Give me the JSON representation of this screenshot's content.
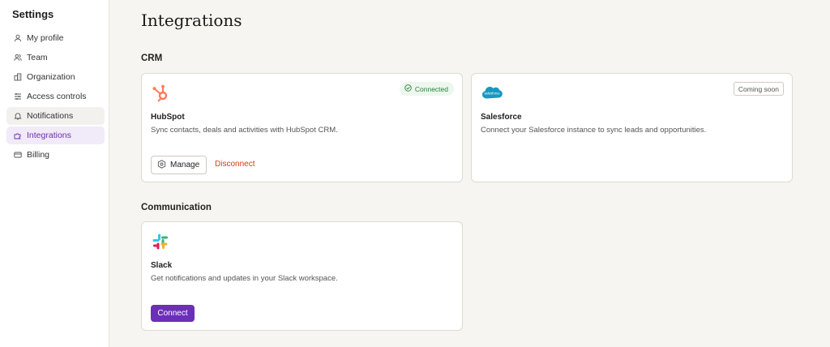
{
  "sidebar": {
    "title": "Settings",
    "items": [
      {
        "label": "My profile",
        "icon": "user-icon"
      },
      {
        "label": "Team",
        "icon": "users-icon"
      },
      {
        "label": "Organization",
        "icon": "building-icon"
      },
      {
        "label": "Access controls",
        "icon": "sliders-icon"
      },
      {
        "label": "Notifications",
        "icon": "bell-icon"
      },
      {
        "label": "Integrations",
        "icon": "puzzle-icon"
      },
      {
        "label": "Billing",
        "icon": "credit-card-icon"
      }
    ],
    "active_item": "Integrations"
  },
  "main": {
    "title": "Integrations",
    "sections": [
      {
        "title": "CRM",
        "cards": [
          {
            "name": "HubSpot",
            "description": "Sync contacts, deals and activities with HubSpot CRM.",
            "status": "Connected",
            "logo": "hubspot-logo",
            "manage_label": "Manage",
            "disconnect_label": "Disconnect"
          },
          {
            "name": "Salesforce",
            "description": "Connect your Salesforce instance to sync leads and opportunities.",
            "status": "Coming soon",
            "logo": "salesforce-logo",
            "logo_text": "salesforce"
          }
        ]
      },
      {
        "title": "Communication",
        "cards": [
          {
            "name": "Slack",
            "description": "Get notifications and updates in your Slack workspace.",
            "logo": "slack-logo",
            "connect_label": "Connect"
          }
        ]
      }
    ]
  },
  "colors": {
    "accent": "#6b2fb8",
    "connected": "#2f7d3a",
    "disconnect": "#c8401e",
    "hubspot": "#ff7a59",
    "salesforce": "#1798c1"
  }
}
